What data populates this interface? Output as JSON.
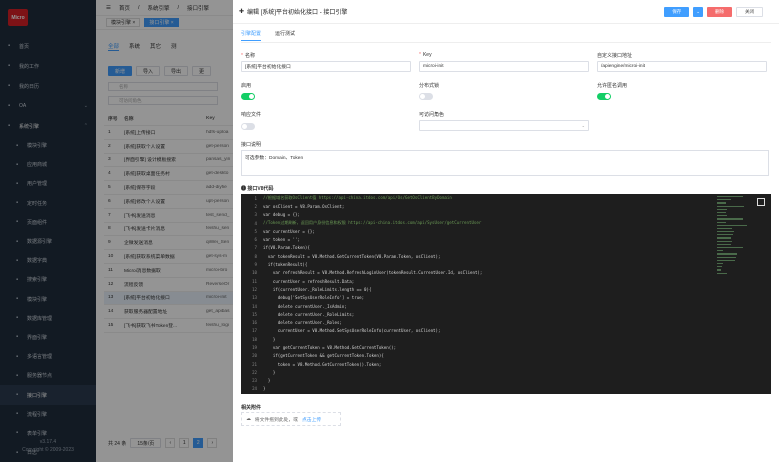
{
  "sidebar": {
    "logo": "Micro",
    "items": [
      {
        "label": "首页",
        "icon": "home-icon",
        "kind": "top"
      },
      {
        "label": "我的工作",
        "icon": "briefcase-icon",
        "kind": "top"
      },
      {
        "label": "我的日历",
        "icon": "calendar-icon",
        "kind": "top"
      },
      {
        "label": "OA",
        "icon": "oa-icon",
        "kind": "top",
        "arrow": "⌄"
      },
      {
        "label": "系统引擎",
        "icon": "engine-icon",
        "kind": "parent",
        "arrow": "⌃"
      },
      {
        "label": "模块引擎",
        "icon": "module-icon",
        "kind": "sub"
      },
      {
        "label": "应用商城",
        "icon": "store-icon",
        "kind": "sub"
      },
      {
        "label": "用户管理",
        "icon": "user-icon",
        "kind": "sub"
      },
      {
        "label": "定时任务",
        "icon": "clock-icon",
        "kind": "sub"
      },
      {
        "label": "页面组件",
        "icon": "component-icon",
        "kind": "sub"
      },
      {
        "label": "数据源引擎",
        "icon": "database-icon",
        "kind": "sub"
      },
      {
        "label": "数据字典",
        "icon": "dictionary-icon",
        "kind": "sub"
      },
      {
        "label": "搜索引擎",
        "icon": "search-engine-icon",
        "kind": "sub"
      },
      {
        "label": "模块引擎",
        "icon": "module-icon",
        "kind": "sub"
      },
      {
        "label": "数据库管理",
        "icon": "db-admin-icon",
        "kind": "sub"
      },
      {
        "label": "界面引擎",
        "icon": "ui-icon",
        "kind": "sub"
      },
      {
        "label": "多语言管理",
        "icon": "language-icon",
        "kind": "sub"
      },
      {
        "label": "服务器节点",
        "icon": "server-icon",
        "kind": "sub"
      },
      {
        "label": "接口引擎",
        "icon": "api-icon",
        "kind": "sub",
        "active": true
      },
      {
        "label": "流程引擎",
        "icon": "flow-icon",
        "kind": "sub"
      },
      {
        "label": "表单引擎",
        "icon": "form-icon",
        "kind": "sub"
      },
      {
        "label": "日志",
        "icon": "log-icon",
        "kind": "sub"
      }
    ],
    "version": "v3.17.4",
    "copyright": "Copyright © 2009-2023"
  },
  "topbar": {
    "breadcrumb": [
      "首页",
      "系统引擎",
      "接口引擎"
    ],
    "tags": [
      {
        "label": "模块引擎 ×",
        "on": false
      },
      {
        "label": "接口引擎 ×",
        "on": true
      }
    ]
  },
  "list": {
    "filter_tabs": [
      "全部",
      "系统",
      "其它",
      "测"
    ],
    "buttons": {
      "add": "新增",
      "import": "导入",
      "export": "导出",
      "more": "更"
    },
    "search_name": "名称",
    "search_path": "可访问角色",
    "columns": [
      "序号",
      "名称",
      "Key"
    ],
    "rows": [
      {
        "no": "1",
        "name": "[系统]上传接口",
        "key": "hdfs-uploa"
      },
      {
        "no": "2",
        "name": "[系统]获取个人设置",
        "key": "get-person"
      },
      {
        "no": "3",
        "name": "[界面引擎] 设计模板搜索",
        "key": "pansas_yin"
      },
      {
        "no": "4",
        "name": "[系统]获取桌面任务村",
        "key": "get-deskto"
      },
      {
        "no": "5",
        "name": "[系统]保存字段",
        "key": "add-diyfie"
      },
      {
        "no": "6",
        "name": "[系统]修改个人设置",
        "key": "upt-person"
      },
      {
        "no": "7",
        "name": "[飞书]发送消息",
        "key": "test_send_"
      },
      {
        "no": "8",
        "name": "[飞书]发送卡片消息",
        "key": "feishu_sen"
      },
      {
        "no": "9",
        "name": "企微发送消息",
        "key": "qiWei_Sen"
      },
      {
        "no": "10",
        "name": "[系统]获取系统菜单数据",
        "key": "get-sys-m"
      },
      {
        "no": "11",
        "name": "Microi消息数据取",
        "key": "microi-bro"
      },
      {
        "no": "12",
        "name": "流程反馈",
        "key": "ReverseOr"
      },
      {
        "no": "13",
        "name": "[系统]平台初始化接口",
        "key": "microi-init",
        "selected": true
      },
      {
        "no": "14",
        "name": "获取服务器配置地址",
        "key": "get_apibas"
      },
      {
        "no": "15",
        "name": "[飞书]获取飞书Token登...",
        "key": "feishu_logi"
      }
    ],
    "pager": {
      "total": "共 24 条",
      "size": "15条/页",
      "pages": [
        "1",
        "2"
      ],
      "current": "2"
    }
  },
  "drawer": {
    "title": "编辑 [系统]平台初始化接口 - 接口引擎",
    "save": "保存",
    "delete": "删除",
    "close": "关闭",
    "tabs": [
      "引擎配置",
      "运行测试"
    ],
    "fields": {
      "name_label": "名称",
      "name_value": "[系统]平台初始化接口",
      "key_label": "Key",
      "key_value": "microi-init",
      "custom_url_label": "自定义接口地址",
      "custom_url_value": "/apiengine/microi-init",
      "enable_label": "启用",
      "enable_on": true,
      "distributed_label": "分布式锁",
      "distributed_on": false,
      "anonymous_label": "允许匿名调用",
      "anonymous_on": true,
      "response_file_label": "响应文件",
      "response_file_on": false,
      "roles_label": "可访问角色",
      "roles_value": "",
      "desc_label": "接口说明",
      "desc_value": "可选参数：Domain、Token",
      "code_label": "接口V8代码"
    },
    "code_lines": [
      "//根据域名获取OsClient值 https://api-china.itdos.com/api/Os/GetOsClientByDomain",
      "var osClient = V8.Param.OsClient;",
      "var debug = {};",
      "//Token过期刷新，返回用户身份信息和权限 https://api-china.itdos.com/api/SysUser/getCurrentUser",
      "var currentUser = {};",
      "var token = '';",
      "if(V8.Param.Token){",
      "  var tokenResult = V8.Method.GetCurrentToken(V8.Param.Token, osClient);",
      "  if(tokenResult){",
      "    var refreshResult = V8.Method.RefreshLoginUser(tokenResult.CurrentUser.Id, osClient);",
      "    currentUser = refreshResult.Data;",
      "    if(currentUser._RoleLimits.length == 0){",
      "      debug['SetSysUserRoleInfo'] = true;",
      "      delete currentUser._IsAdmin;",
      "      delete currentUser._RoleLimits;",
      "      delete currentUser._Roles;",
      "      currentUser = V8.Method.SetSysUserRoleInfo(currentUser, osClient);",
      "    }",
      "    var getCurrentToken = V8.Method.GetCurrentToken();",
      "    if(getCurrentToken && getCurrentToken.Token){",
      "      token = V8.Method.GetCurrentToken().Token;",
      "    }",
      "  }",
      "}",
      "if(V8.Param.Domain){"
    ],
    "attachments_label": "相关附件",
    "upload_text": "将文件拖到此处，或",
    "upload_link": "点击上传"
  }
}
